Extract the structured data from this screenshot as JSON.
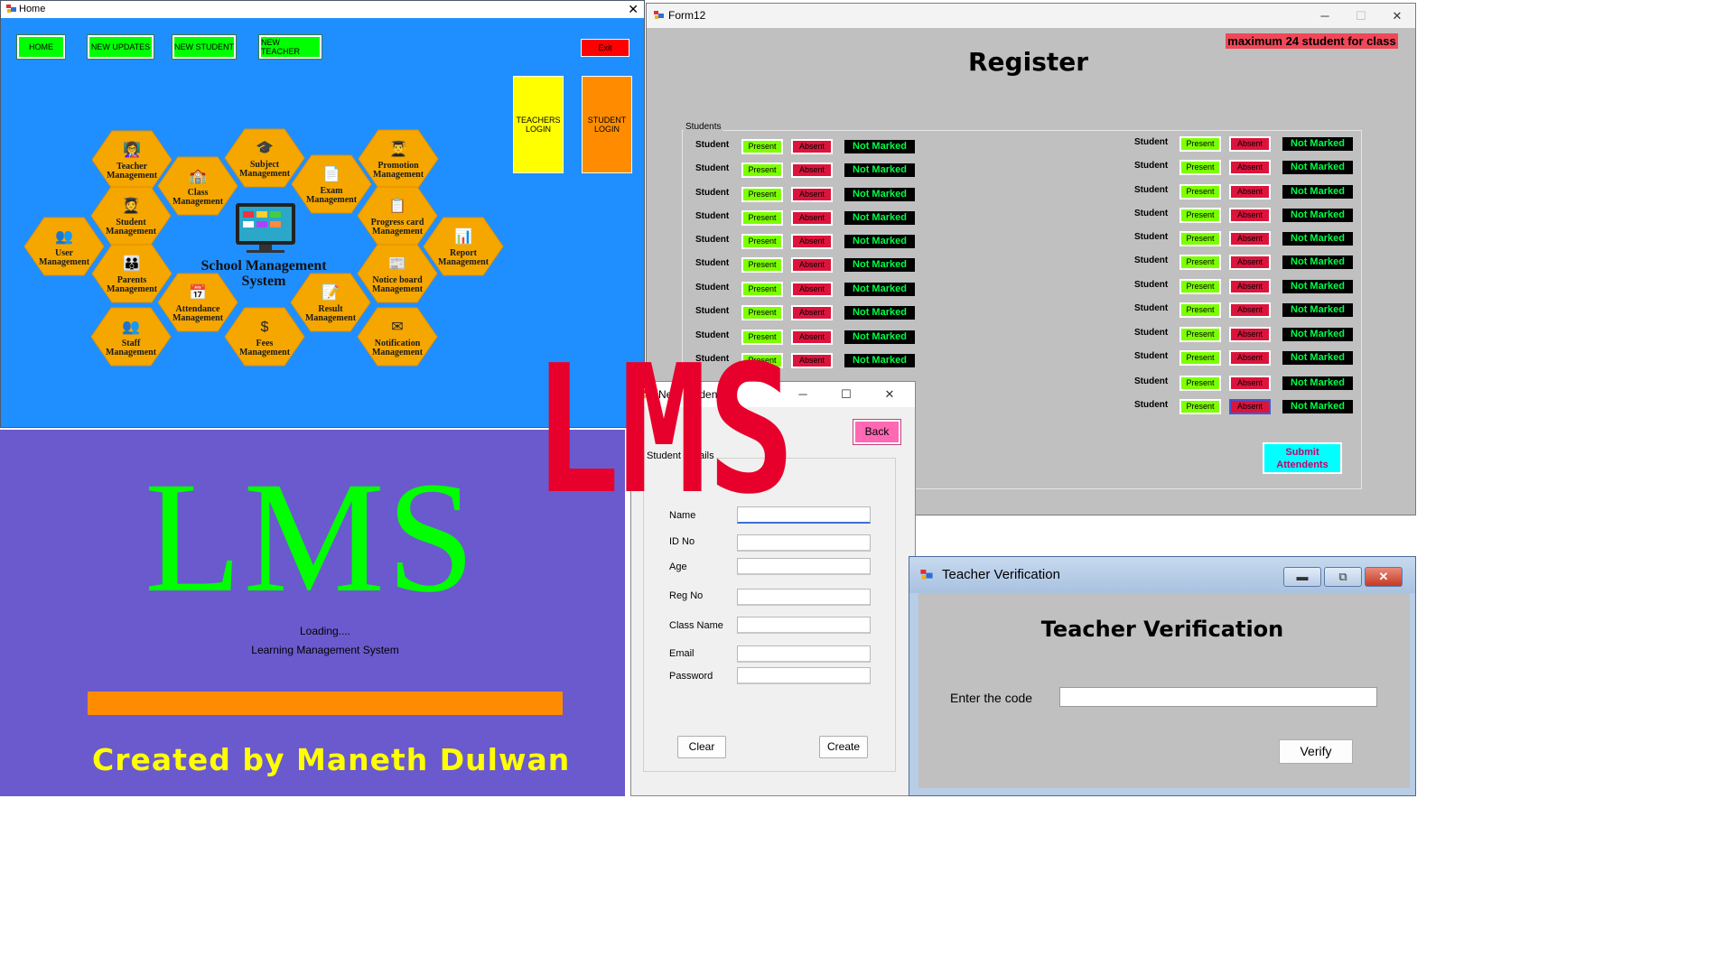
{
  "home": {
    "title": "Home",
    "nav": [
      {
        "label": "HOME",
        "name": "home-button"
      },
      {
        "label": "NEW UPDATES",
        "name": "new-updates-button"
      },
      {
        "label": "NEW STUDENT",
        "name": "new-student-button"
      },
      {
        "label": "NEW TEACHER",
        "name": "new-teacher-button"
      }
    ],
    "exit_label": "Exit",
    "teachers_login": "TEACHERS LOGIN",
    "student_login": "STUDENT LOGIN",
    "center_title": "School Management System",
    "hex_color": "#f5a700",
    "modules": [
      {
        "l1": "Teacher",
        "l2": "Management"
      },
      {
        "l1": "Class",
        "l2": "Management"
      },
      {
        "l1": "Subject",
        "l2": "Management"
      },
      {
        "l1": "Exam",
        "l2": "Management"
      },
      {
        "l1": "Promotion",
        "l2": "Management"
      },
      {
        "l1": "Student",
        "l2": "Management"
      },
      {
        "l1": "Progress card",
        "l2": "Management"
      },
      {
        "l1": "User",
        "l2": "Management"
      },
      {
        "l1": "Report",
        "l2": "Management"
      },
      {
        "l1": "Parents",
        "l2": "Management"
      },
      {
        "l1": "Notice board",
        "l2": "Management"
      },
      {
        "l1": "Attendance",
        "l2": "Management"
      },
      {
        "l1": "Result",
        "l2": "Management"
      },
      {
        "l1": "Staff",
        "l2": "Management"
      },
      {
        "l1": "Fees",
        "l2": "Management"
      },
      {
        "l1": "Notification",
        "l2": "Management"
      }
    ]
  },
  "splash": {
    "logo": "LMS",
    "loading": "Loading....",
    "subtitle": "Learning Management System",
    "credit": "Created by Maneth Dulwan",
    "progress": 1.0
  },
  "register": {
    "title": "Form12",
    "heading": "Register",
    "max_note": "maximum 24 student for class",
    "group_label": "Students",
    "student_label": "Student",
    "present_label": "Present",
    "absent_label": "Absent",
    "status_label": "Not Marked",
    "submit_label": "Submit Attendents",
    "left_count": 10,
    "right_count": 12
  },
  "new_student": {
    "title": "New Student",
    "back_label": "Back",
    "group_label": "Student Details",
    "fields": [
      {
        "label": "Name",
        "value": ""
      },
      {
        "label": "ID No",
        "value": ""
      },
      {
        "label": "Age",
        "value": ""
      },
      {
        "label": "Reg No",
        "value": ""
      },
      {
        "label": "Class Name",
        "value": ""
      },
      {
        "label": "Email",
        "value": ""
      },
      {
        "label": "Password",
        "value": ""
      }
    ],
    "clear_label": "Clear",
    "create_label": "Create"
  },
  "teacher_verification": {
    "title": "Teacher Verification",
    "heading": "Teacher Verification",
    "code_label": "Enter the code",
    "code_value": "",
    "verify_label": "Verify"
  },
  "overlay_logo": "LMS",
  "colors": {
    "home_bg": "#1f8fff",
    "nav_green": "#00ff00",
    "splash_bg": "#6a5acd",
    "splash_logo": "#00ff00",
    "credit_yellow": "#ffff00",
    "progress_orange": "#ff8c00",
    "lms_red": "#e8002d",
    "present_green": "#7cff00",
    "absent_red": "#dc143c",
    "submit_cyan": "#00ffff",
    "back_pink": "#ff69b4"
  }
}
